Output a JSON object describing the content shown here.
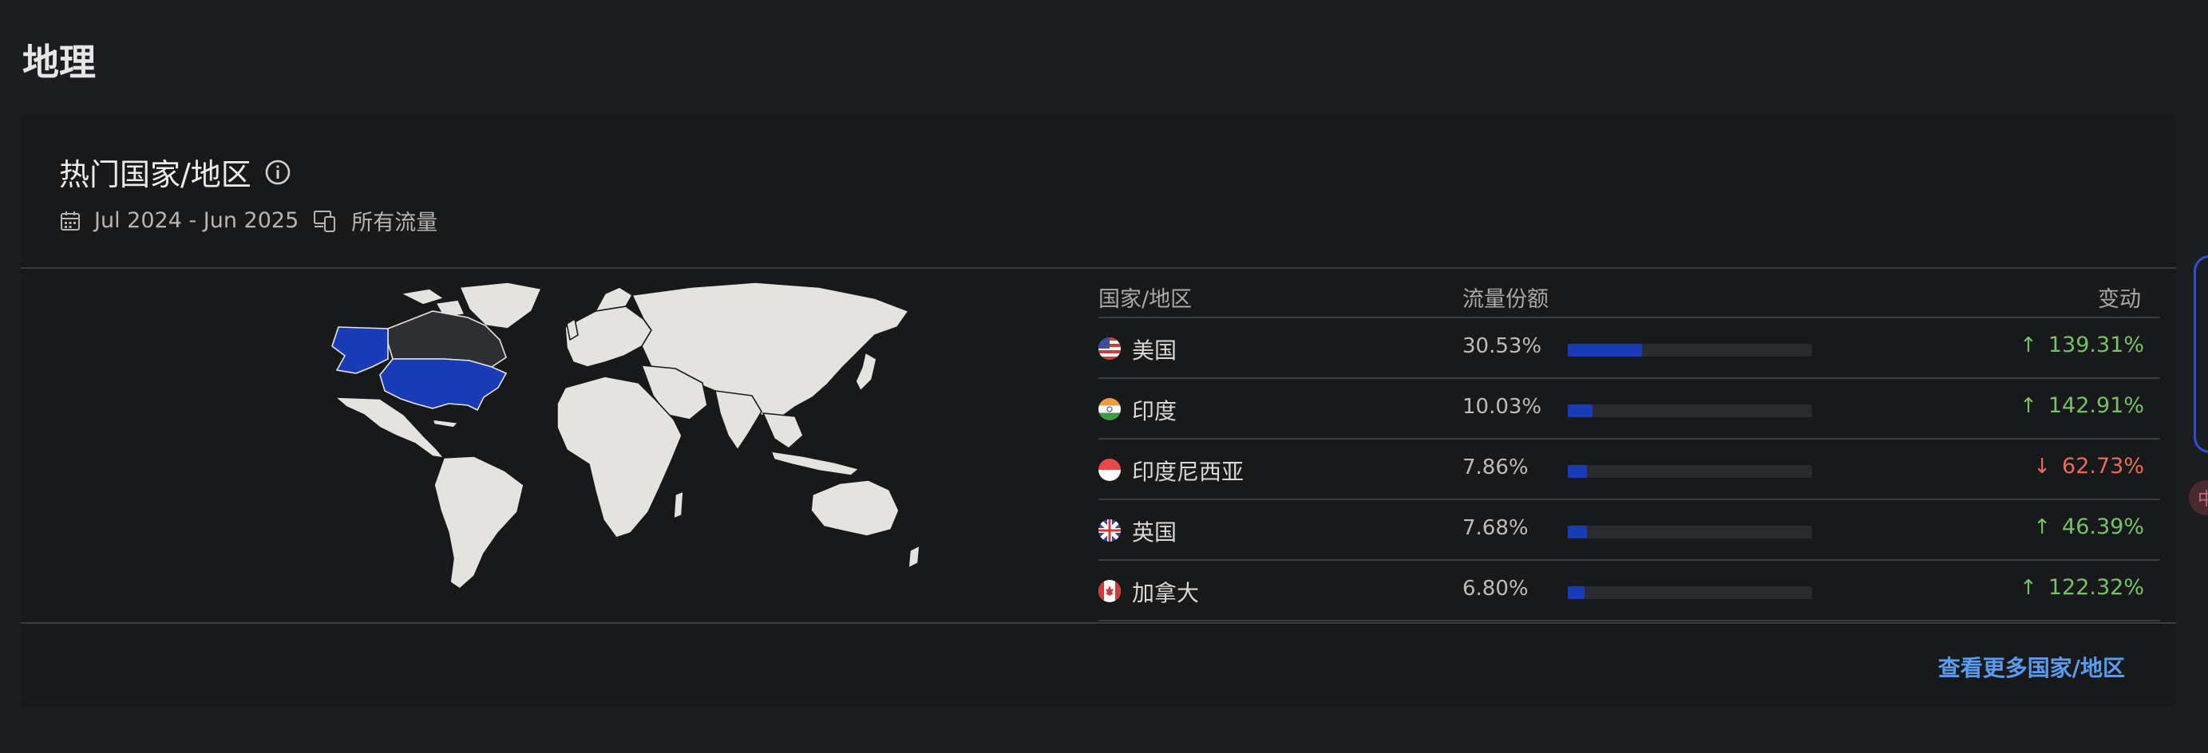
{
  "page": {
    "title": "地理"
  },
  "card": {
    "title": "热门国家/地区",
    "date_range": "Jul 2024 - Jun 2025",
    "traffic_filter": "所有流量"
  },
  "table": {
    "headers": {
      "country": "国家/地区",
      "share": "流量份额",
      "change": "变动"
    },
    "rows": [
      {
        "name": "美国",
        "share": "30.53%",
        "share_value": 30.53,
        "change": "139.31%",
        "direction": "up",
        "flag": "us-flag"
      },
      {
        "name": "印度",
        "share": "10.03%",
        "share_value": 10.03,
        "change": "142.91%",
        "direction": "up",
        "flag": "in-flag"
      },
      {
        "name": "印度尼西亚",
        "share": "7.86%",
        "share_value": 7.86,
        "change": "62.73%",
        "direction": "down",
        "flag": "id-flag"
      },
      {
        "name": "英国",
        "share": "7.68%",
        "share_value": 7.68,
        "change": "46.39%",
        "direction": "up",
        "flag": "gb-flag"
      },
      {
        "name": "加拿大",
        "share": "6.80%",
        "share_value": 6.8,
        "change": "122.32%",
        "direction": "up",
        "flag": "ca-flag"
      }
    ]
  },
  "see_more": "查看更多国家/地区",
  "colors": {
    "accent_bar": "#1a3bb8",
    "up": "#74c365",
    "down": "#ea6b56",
    "link": "#5b9bf0"
  },
  "overlay": {
    "bubble_text": "中"
  }
}
